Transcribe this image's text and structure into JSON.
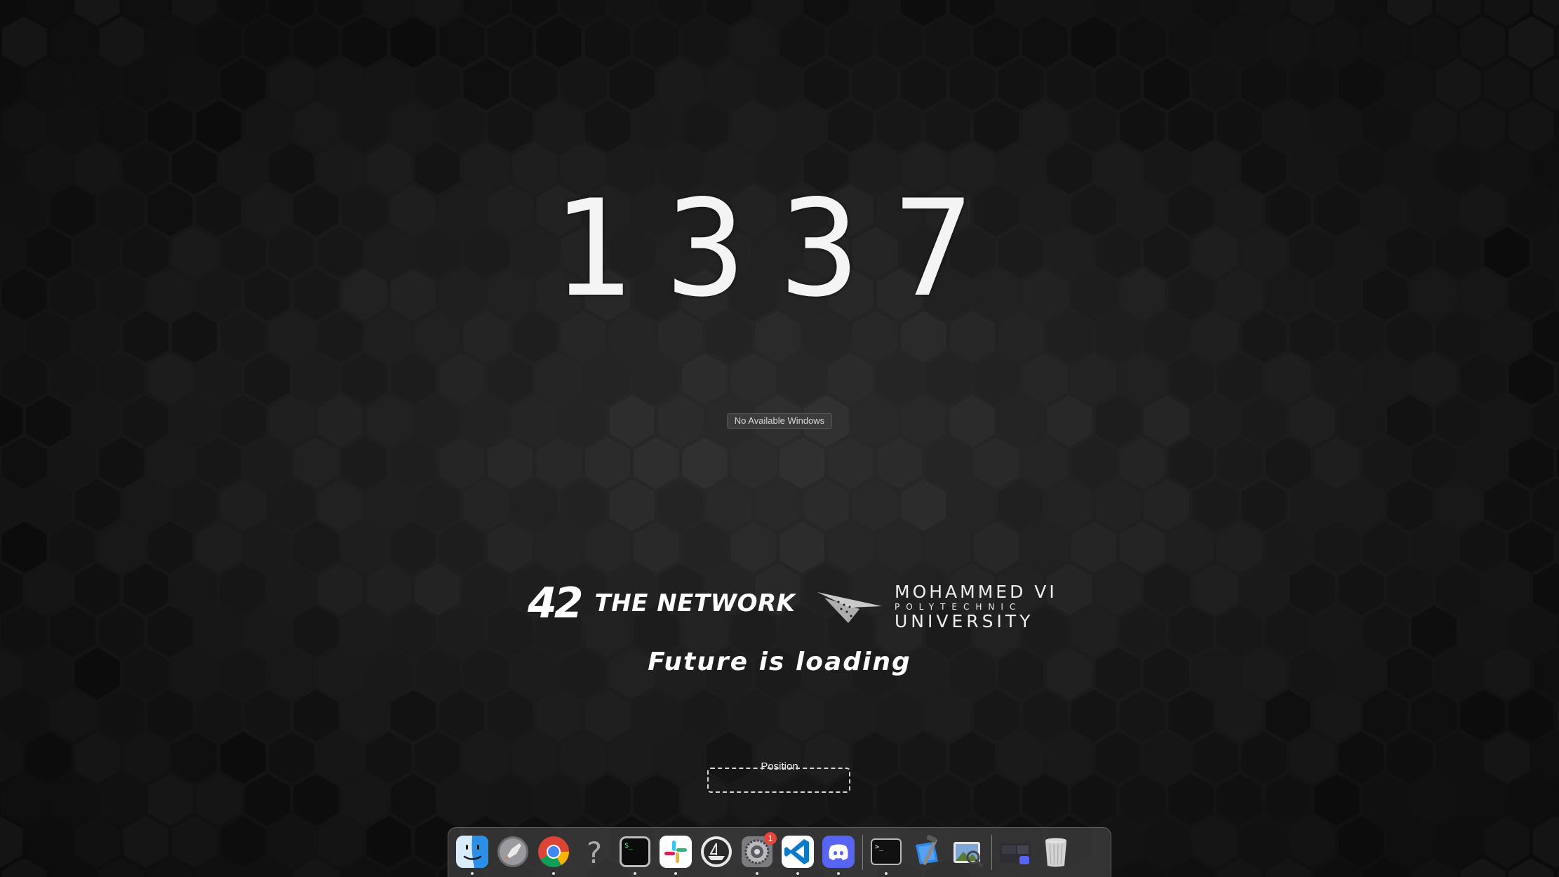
{
  "screen": {
    "big_number": "1337",
    "no_windows_label": "No Available Windows",
    "logo_42": {
      "mark": "42",
      "text": "THE NETWORK"
    },
    "logo_um6p": {
      "line1": "MOHAMMED VI",
      "line2": "POLYTECHNIC",
      "line3": "UNIVERSITY"
    },
    "tagline": "Future is loading",
    "position_label": "Position"
  },
  "dock": {
    "items": [
      {
        "name": "Finder",
        "icon": "finder-icon",
        "running": true
      },
      {
        "name": "Launchpad",
        "icon": "launchpad-icon",
        "running": false
      },
      {
        "name": "Google Chrome",
        "icon": "chrome-icon",
        "running": true
      },
      {
        "name": "Unknown app",
        "icon": "question-mark-icon",
        "running": false
      },
      {
        "name": "iTerm",
        "icon": "iterm-icon",
        "running": true
      },
      {
        "name": "Slack",
        "icon": "slack-icon",
        "running": true
      },
      {
        "name": "Managed Software Center",
        "icon": "msc-icon",
        "running": false
      },
      {
        "name": "System Preferences",
        "icon": "system-preferences-icon",
        "running": true,
        "badge": "1"
      },
      {
        "name": "Visual Studio Code",
        "icon": "vscode-icon",
        "running": true
      },
      {
        "name": "Discord",
        "icon": "discord-icon",
        "running": true
      },
      {
        "name": "Terminal",
        "icon": "terminal-icon",
        "running": true
      },
      {
        "name": "Xcode",
        "icon": "xcode-icon",
        "running": false
      },
      {
        "name": "Preview",
        "icon": "preview-icon",
        "running": false
      },
      {
        "name": "Downloads",
        "icon": "downloads-stack-icon",
        "running": false
      },
      {
        "name": "Trash",
        "icon": "trash-icon",
        "running": false
      }
    ],
    "colors": {
      "chrome_red": "#db4437",
      "chrome_yellow": "#f4b400",
      "chrome_green": "#0f9d58",
      "chrome_blue": "#4285f4",
      "vscode_blue": "#0a7acc",
      "discord_blurple": "#5865f2",
      "badge_red": "#e8443a",
      "finder_blue": "#2b8fe8"
    }
  }
}
